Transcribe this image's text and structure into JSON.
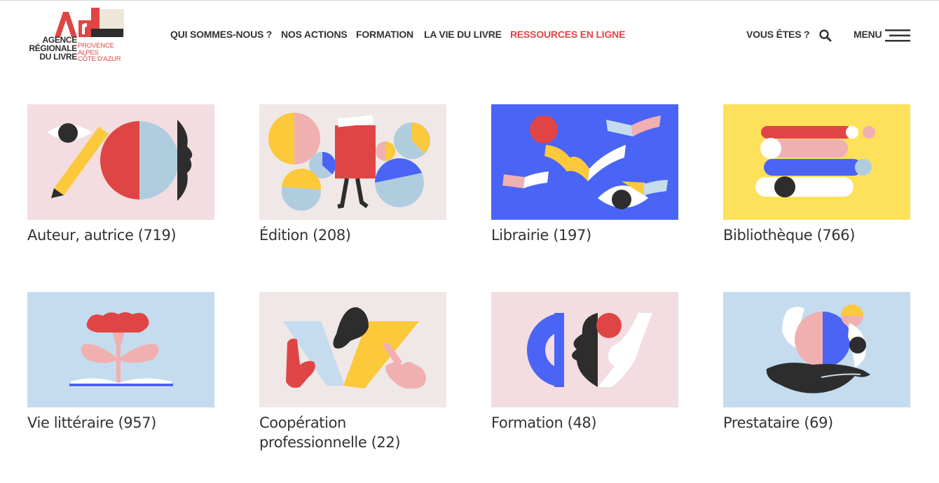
{
  "logo": {
    "letters": "ArL",
    "name_line1": "AGENCE",
    "name_line2": "RÉGIONALE",
    "name_line3": "DU LIVRE",
    "region_line1": "PROVENCE",
    "region_line2": "ALPES",
    "region_line3": "CÔTE D'AZUR"
  },
  "nav": {
    "items": [
      {
        "label": "QUI SOMMES-NOUS ?"
      },
      {
        "label": "NOS ACTIONS"
      },
      {
        "label": "FORMATION"
      },
      {
        "label": "LA VIE DU LIVRE"
      },
      {
        "label": "RESSOURCES EN LIGNE"
      }
    ],
    "vous_etes": "VOUS ÊTES ?",
    "search_icon": "search-icon",
    "menu_label": "MENU",
    "menu_icon": "hamburger-menu-icon"
  },
  "colors": {
    "accent": "#e04545",
    "text": "#333333",
    "blue": "#4a64f5",
    "yellow": "#fbc93a",
    "pink": "#f3dde0",
    "lightblue": "#c5dcef"
  },
  "categories": [
    {
      "title": "Auteur, autrice (719)"
    },
    {
      "title": "Édition (208)"
    },
    {
      "title": "Librairie (197)"
    },
    {
      "title": "Bibliothèque (766)"
    },
    {
      "title": "Vie littéraire (957)"
    },
    {
      "title": "Coopération professionnelle (22)"
    },
    {
      "title": "Formation (48)"
    },
    {
      "title": "Prestataire (69)"
    }
  ]
}
